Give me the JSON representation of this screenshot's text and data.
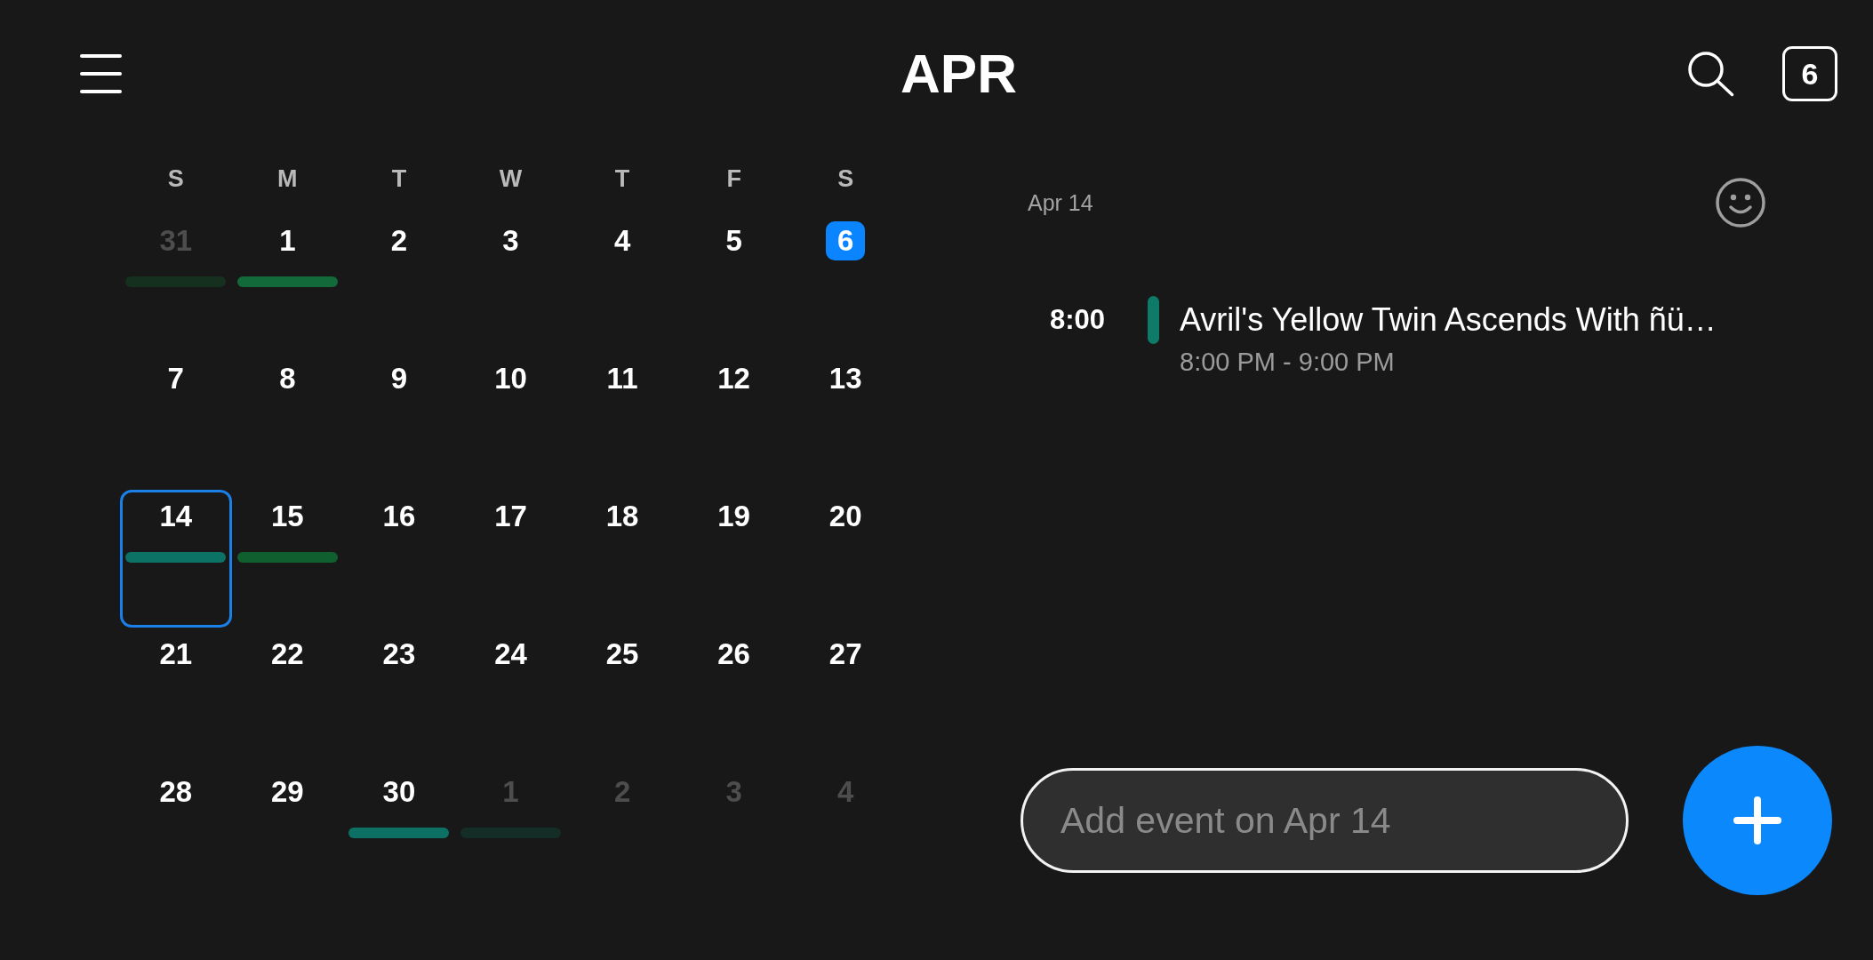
{
  "header": {
    "month": "APR",
    "today_button": "6"
  },
  "calendar": {
    "weekdays": [
      "S",
      "M",
      "T",
      "W",
      "T",
      "F",
      "S"
    ],
    "days": [
      {
        "day": "31",
        "in_month": false,
        "today": false,
        "selected": false,
        "events": [
          {
            "color": "#15301f"
          }
        ]
      },
      {
        "day": "1",
        "in_month": true,
        "today": false,
        "selected": false,
        "events": [
          {
            "color": "#126a3a"
          }
        ]
      },
      {
        "day": "2",
        "in_month": true,
        "today": false,
        "selected": false
      },
      {
        "day": "3",
        "in_month": true,
        "today": false,
        "selected": false
      },
      {
        "day": "4",
        "in_month": true,
        "today": false,
        "selected": false
      },
      {
        "day": "5",
        "in_month": true,
        "today": false,
        "selected": false
      },
      {
        "day": "6",
        "in_month": true,
        "today": true,
        "selected": false
      },
      {
        "day": "7",
        "in_month": true,
        "today": false,
        "selected": false
      },
      {
        "day": "8",
        "in_month": true,
        "today": false,
        "selected": false
      },
      {
        "day": "9",
        "in_month": true,
        "today": false,
        "selected": false
      },
      {
        "day": "10",
        "in_month": true,
        "today": false,
        "selected": false
      },
      {
        "day": "11",
        "in_month": true,
        "today": false,
        "selected": false
      },
      {
        "day": "12",
        "in_month": true,
        "today": false,
        "selected": false
      },
      {
        "day": "13",
        "in_month": true,
        "today": false,
        "selected": false
      },
      {
        "day": "14",
        "in_month": true,
        "today": false,
        "selected": true,
        "events": [
          {
            "color": "#0d7266"
          }
        ]
      },
      {
        "day": "15",
        "in_month": true,
        "today": false,
        "selected": false,
        "events": [
          {
            "color": "#10602f"
          }
        ]
      },
      {
        "day": "16",
        "in_month": true,
        "today": false,
        "selected": false
      },
      {
        "day": "17",
        "in_month": true,
        "today": false,
        "selected": false
      },
      {
        "day": "18",
        "in_month": true,
        "today": false,
        "selected": false
      },
      {
        "day": "19",
        "in_month": true,
        "today": false,
        "selected": false
      },
      {
        "day": "20",
        "in_month": true,
        "today": false,
        "selected": false
      },
      {
        "day": "21",
        "in_month": true,
        "today": false,
        "selected": false
      },
      {
        "day": "22",
        "in_month": true,
        "today": false,
        "selected": false
      },
      {
        "day": "23",
        "in_month": true,
        "today": false,
        "selected": false
      },
      {
        "day": "24",
        "in_month": true,
        "today": false,
        "selected": false
      },
      {
        "day": "25",
        "in_month": true,
        "today": false,
        "selected": false
      },
      {
        "day": "26",
        "in_month": true,
        "today": false,
        "selected": false
      },
      {
        "day": "27",
        "in_month": true,
        "today": false,
        "selected": false
      },
      {
        "day": "28",
        "in_month": true,
        "today": false,
        "selected": false
      },
      {
        "day": "29",
        "in_month": true,
        "today": false,
        "selected": false
      },
      {
        "day": "30",
        "in_month": true,
        "today": false,
        "selected": false,
        "events": [
          {
            "color": "#0c7064"
          }
        ]
      },
      {
        "day": "1",
        "in_month": false,
        "today": false,
        "selected": false,
        "events": [
          {
            "color": "#142d26"
          }
        ]
      },
      {
        "day": "2",
        "in_month": false,
        "today": false,
        "selected": false
      },
      {
        "day": "3",
        "in_month": false,
        "today": false,
        "selected": false
      },
      {
        "day": "4",
        "in_month": false,
        "today": false,
        "selected": false
      }
    ]
  },
  "agenda": {
    "date": "Apr 14",
    "events": [
      {
        "time": "8:00",
        "title": "Avril's Yellow Twin Ascends With ñü…",
        "time_range": "8:00 PM - 9:00 PM",
        "color": "#0e7a68"
      }
    ]
  },
  "add_event": {
    "placeholder": "Add event on Apr 14"
  }
}
